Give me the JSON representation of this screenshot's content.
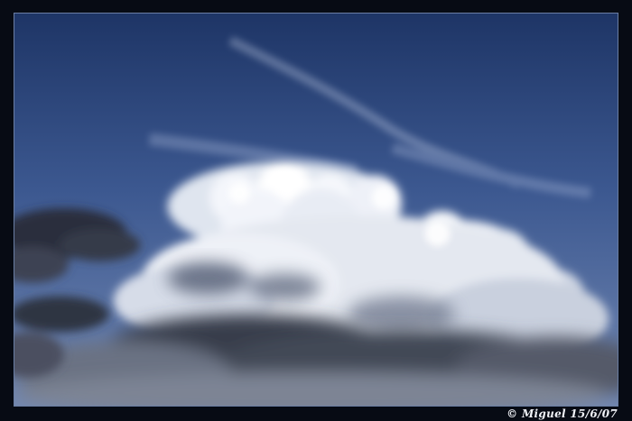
{
  "photo": {
    "subject": "cumulus-cloud-sky",
    "sky_color_top": "#1c3362",
    "sky_color_bottom": "#6b83b0",
    "frame_color": "#070b14"
  },
  "credit": {
    "text": "© Miguel 15/6/07"
  }
}
